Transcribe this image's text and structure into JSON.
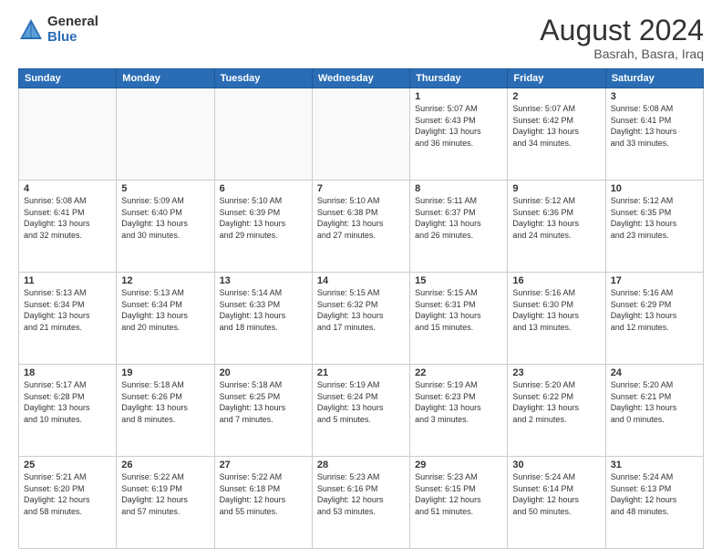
{
  "header": {
    "logo_general": "General",
    "logo_blue": "Blue",
    "main_title": "August 2024",
    "subtitle": "Basrah, Basra, Iraq"
  },
  "days_of_week": [
    "Sunday",
    "Monday",
    "Tuesday",
    "Wednesday",
    "Thursday",
    "Friday",
    "Saturday"
  ],
  "weeks": [
    [
      {
        "day": "",
        "info": ""
      },
      {
        "day": "",
        "info": ""
      },
      {
        "day": "",
        "info": ""
      },
      {
        "day": "",
        "info": ""
      },
      {
        "day": "1",
        "info": "Sunrise: 5:07 AM\nSunset: 6:43 PM\nDaylight: 13 hours\nand 36 minutes."
      },
      {
        "day": "2",
        "info": "Sunrise: 5:07 AM\nSunset: 6:42 PM\nDaylight: 13 hours\nand 34 minutes."
      },
      {
        "day": "3",
        "info": "Sunrise: 5:08 AM\nSunset: 6:41 PM\nDaylight: 13 hours\nand 33 minutes."
      }
    ],
    [
      {
        "day": "4",
        "info": "Sunrise: 5:08 AM\nSunset: 6:41 PM\nDaylight: 13 hours\nand 32 minutes."
      },
      {
        "day": "5",
        "info": "Sunrise: 5:09 AM\nSunset: 6:40 PM\nDaylight: 13 hours\nand 30 minutes."
      },
      {
        "day": "6",
        "info": "Sunrise: 5:10 AM\nSunset: 6:39 PM\nDaylight: 13 hours\nand 29 minutes."
      },
      {
        "day": "7",
        "info": "Sunrise: 5:10 AM\nSunset: 6:38 PM\nDaylight: 13 hours\nand 27 minutes."
      },
      {
        "day": "8",
        "info": "Sunrise: 5:11 AM\nSunset: 6:37 PM\nDaylight: 13 hours\nand 26 minutes."
      },
      {
        "day": "9",
        "info": "Sunrise: 5:12 AM\nSunset: 6:36 PM\nDaylight: 13 hours\nand 24 minutes."
      },
      {
        "day": "10",
        "info": "Sunrise: 5:12 AM\nSunset: 6:35 PM\nDaylight: 13 hours\nand 23 minutes."
      }
    ],
    [
      {
        "day": "11",
        "info": "Sunrise: 5:13 AM\nSunset: 6:34 PM\nDaylight: 13 hours\nand 21 minutes."
      },
      {
        "day": "12",
        "info": "Sunrise: 5:13 AM\nSunset: 6:34 PM\nDaylight: 13 hours\nand 20 minutes."
      },
      {
        "day": "13",
        "info": "Sunrise: 5:14 AM\nSunset: 6:33 PM\nDaylight: 13 hours\nand 18 minutes."
      },
      {
        "day": "14",
        "info": "Sunrise: 5:15 AM\nSunset: 6:32 PM\nDaylight: 13 hours\nand 17 minutes."
      },
      {
        "day": "15",
        "info": "Sunrise: 5:15 AM\nSunset: 6:31 PM\nDaylight: 13 hours\nand 15 minutes."
      },
      {
        "day": "16",
        "info": "Sunrise: 5:16 AM\nSunset: 6:30 PM\nDaylight: 13 hours\nand 13 minutes."
      },
      {
        "day": "17",
        "info": "Sunrise: 5:16 AM\nSunset: 6:29 PM\nDaylight: 13 hours\nand 12 minutes."
      }
    ],
    [
      {
        "day": "18",
        "info": "Sunrise: 5:17 AM\nSunset: 6:28 PM\nDaylight: 13 hours\nand 10 minutes."
      },
      {
        "day": "19",
        "info": "Sunrise: 5:18 AM\nSunset: 6:26 PM\nDaylight: 13 hours\nand 8 minutes."
      },
      {
        "day": "20",
        "info": "Sunrise: 5:18 AM\nSunset: 6:25 PM\nDaylight: 13 hours\nand 7 minutes."
      },
      {
        "day": "21",
        "info": "Sunrise: 5:19 AM\nSunset: 6:24 PM\nDaylight: 13 hours\nand 5 minutes."
      },
      {
        "day": "22",
        "info": "Sunrise: 5:19 AM\nSunset: 6:23 PM\nDaylight: 13 hours\nand 3 minutes."
      },
      {
        "day": "23",
        "info": "Sunrise: 5:20 AM\nSunset: 6:22 PM\nDaylight: 13 hours\nand 2 minutes."
      },
      {
        "day": "24",
        "info": "Sunrise: 5:20 AM\nSunset: 6:21 PM\nDaylight: 13 hours\nand 0 minutes."
      }
    ],
    [
      {
        "day": "25",
        "info": "Sunrise: 5:21 AM\nSunset: 6:20 PM\nDaylight: 12 hours\nand 58 minutes."
      },
      {
        "day": "26",
        "info": "Sunrise: 5:22 AM\nSunset: 6:19 PM\nDaylight: 12 hours\nand 57 minutes."
      },
      {
        "day": "27",
        "info": "Sunrise: 5:22 AM\nSunset: 6:18 PM\nDaylight: 12 hours\nand 55 minutes."
      },
      {
        "day": "28",
        "info": "Sunrise: 5:23 AM\nSunset: 6:16 PM\nDaylight: 12 hours\nand 53 minutes."
      },
      {
        "day": "29",
        "info": "Sunrise: 5:23 AM\nSunset: 6:15 PM\nDaylight: 12 hours\nand 51 minutes."
      },
      {
        "day": "30",
        "info": "Sunrise: 5:24 AM\nSunset: 6:14 PM\nDaylight: 12 hours\nand 50 minutes."
      },
      {
        "day": "31",
        "info": "Sunrise: 5:24 AM\nSunset: 6:13 PM\nDaylight: 12 hours\nand 48 minutes."
      }
    ]
  ]
}
